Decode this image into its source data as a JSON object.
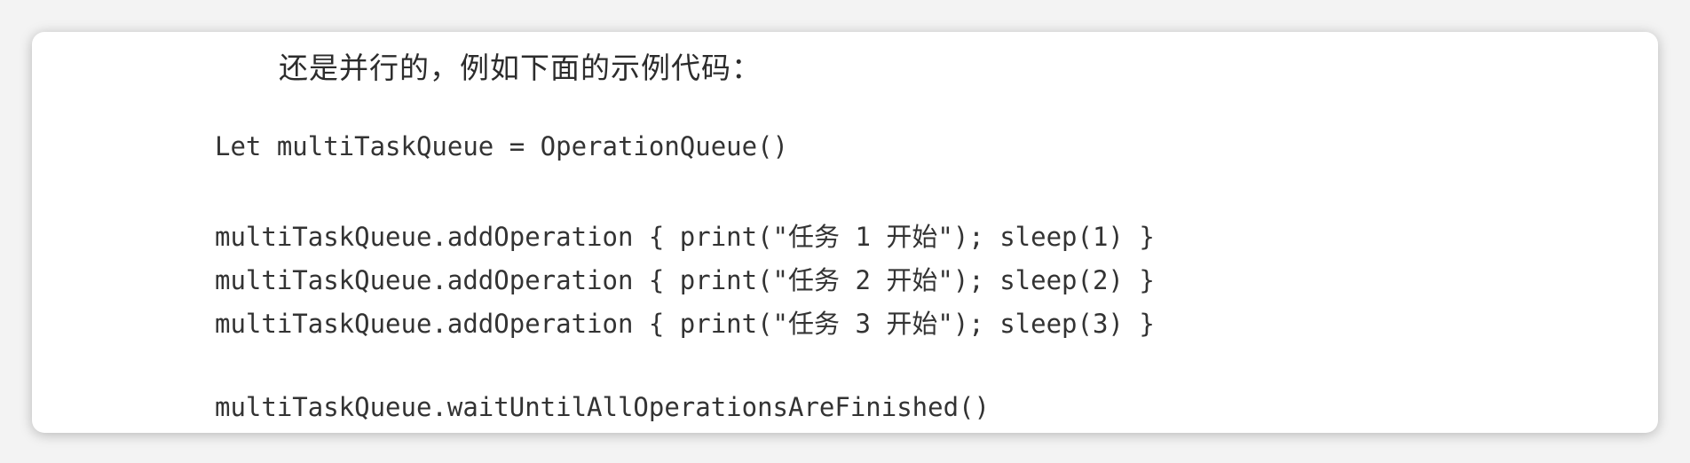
{
  "document": {
    "intro_text": "还是并行的，例如下面的示例代码：",
    "code_lines": [
      "Let multiTaskQueue = OperationQueue()",
      "multiTaskQueue.addOperation { print(\"任务 1 开始\"); sleep(1) }",
      "multiTaskQueue.addOperation { print(\"任务 2 开始\"); sleep(2) }",
      "multiTaskQueue.addOperation { print(\"任务 3 开始\"); sleep(3) }",
      "multiTaskQueue.waitUntilAllOperationsAreFinished()"
    ]
  }
}
